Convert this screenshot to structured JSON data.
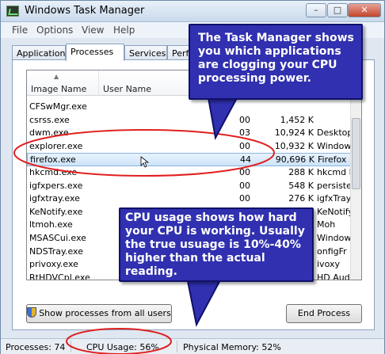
{
  "window": {
    "title": "Windows Task Manager"
  },
  "menu": [
    "File",
    "Options",
    "View",
    "Help"
  ],
  "tabs": [
    "Applications",
    "Processes",
    "Services",
    "Perform"
  ],
  "columns": {
    "image_name": "Image Name",
    "user_name": "User Name"
  },
  "processes": [
    {
      "name": "CFSwMgr.exe",
      "cpu": "",
      "mem": "",
      "desc": ""
    },
    {
      "name": "csrss.exe",
      "cpu": "00",
      "mem": "1,452 K",
      "desc": ""
    },
    {
      "name": "dwm.exe",
      "cpu": "03",
      "mem": "10,924 K",
      "desc": "Desktop"
    },
    {
      "name": "explorer.exe",
      "cpu": "00",
      "mem": "10,932 K",
      "desc": "Window"
    },
    {
      "name": "firefox.exe",
      "cpu": "44",
      "mem": "90,696 K",
      "desc": "Firefox"
    },
    {
      "name": "hkcmd.exe",
      "cpu": "00",
      "mem": "288 K",
      "desc": "hkcmd M"
    },
    {
      "name": "igfxpers.exe",
      "cpu": "00",
      "mem": "548 K",
      "desc": "persiste"
    },
    {
      "name": "igfxtray.exe",
      "cpu": "00",
      "mem": "276 K",
      "desc": "igfxTray"
    },
    {
      "name": "KeNotify.exe",
      "cpu": "",
      "mem": "",
      "desc": "KeNotify"
    },
    {
      "name": "ltmoh.exe",
      "cpu": "",
      "mem": "",
      "desc": "Moh"
    },
    {
      "name": "MSASCui.exe",
      "cpu": "",
      "mem": "",
      "desc": "Window"
    },
    {
      "name": "NDSTray.exe",
      "cpu": "",
      "mem": "",
      "desc": "onfigFr"
    },
    {
      "name": "privoxy.exe",
      "cpu": "",
      "mem": "",
      "desc": "ivoxy"
    },
    {
      "name": "RtHDVCpl.exe",
      "cpu": "",
      "mem": "",
      "desc": "HD Audi"
    }
  ],
  "buttons": {
    "show_all": "Show processes from all users",
    "end_process": "End Process"
  },
  "status": {
    "processes": "Processes: 74",
    "cpu": "CPU Usage: 56%",
    "memory": "Physical Memory: 52%"
  },
  "annotations": {
    "top": "The Task Manager shows you which applications are clogging your CPU processing power.",
    "bottom": "CPU usage shows how hard your CPU is working.  Usually the true usuage is 10%-40% higher than the actual reading."
  },
  "colors": {
    "callout": "#3030b0",
    "highlight": "#e02020"
  }
}
